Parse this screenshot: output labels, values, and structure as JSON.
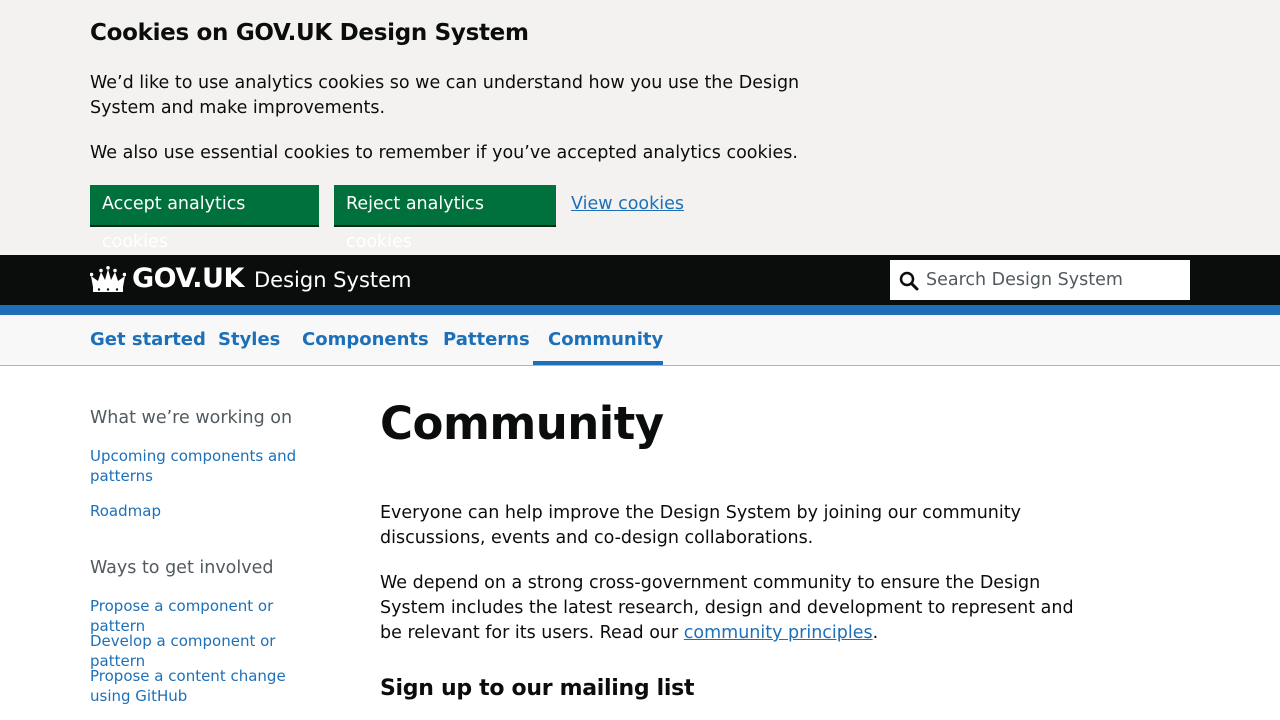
{
  "cookie_banner": {
    "title": "Cookies on GOV.UK Design System",
    "paragraph_1": "We’d like to use analytics cookies so we can understand how you use the Design System and make improvements.",
    "paragraph_2": "We also use essential cookies to remember if you’ve accepted analytics cookies.",
    "accept_label": "Accept analytics cookies",
    "reject_label": "Reject analytics cookies",
    "view_label": "View cookies"
  },
  "header": {
    "logo_text": "GOV.UK",
    "product_name": "Design System",
    "search_placeholder": "Search Design System"
  },
  "nav": {
    "items": [
      {
        "label": "Get started"
      },
      {
        "label": "Styles"
      },
      {
        "label": "Components"
      },
      {
        "label": "Patterns"
      },
      {
        "label": "Community",
        "active": true
      }
    ]
  },
  "sidebar": {
    "sections": [
      {
        "heading": "What we’re working on",
        "links": [
          "Upcoming components and patterns",
          "Roadmap"
        ]
      },
      {
        "heading": "Ways to get involved",
        "links": [
          "Propose a component or pattern",
          "Develop a component or pattern",
          "Propose a content change using GitHub"
        ]
      }
    ]
  },
  "main": {
    "title": "Community",
    "paragraph_1": "Everyone can help improve the Design System by joining our community discussions, events and co-design collaborations.",
    "paragraph_2_text": "We depend on a strong cross-government community to ensure the Design System includes the latest research, design and development to represent and be relevant for its users. Read our ",
    "paragraph_2_link": "community principles",
    "paragraph_2_end": ".",
    "subheading": "Sign up to our mailing list"
  },
  "colors": {
    "brand_green": "#00703c",
    "link_blue": "#1d70b8",
    "header_black": "#0b0c0c",
    "banner_grey": "#f3f2f1"
  }
}
